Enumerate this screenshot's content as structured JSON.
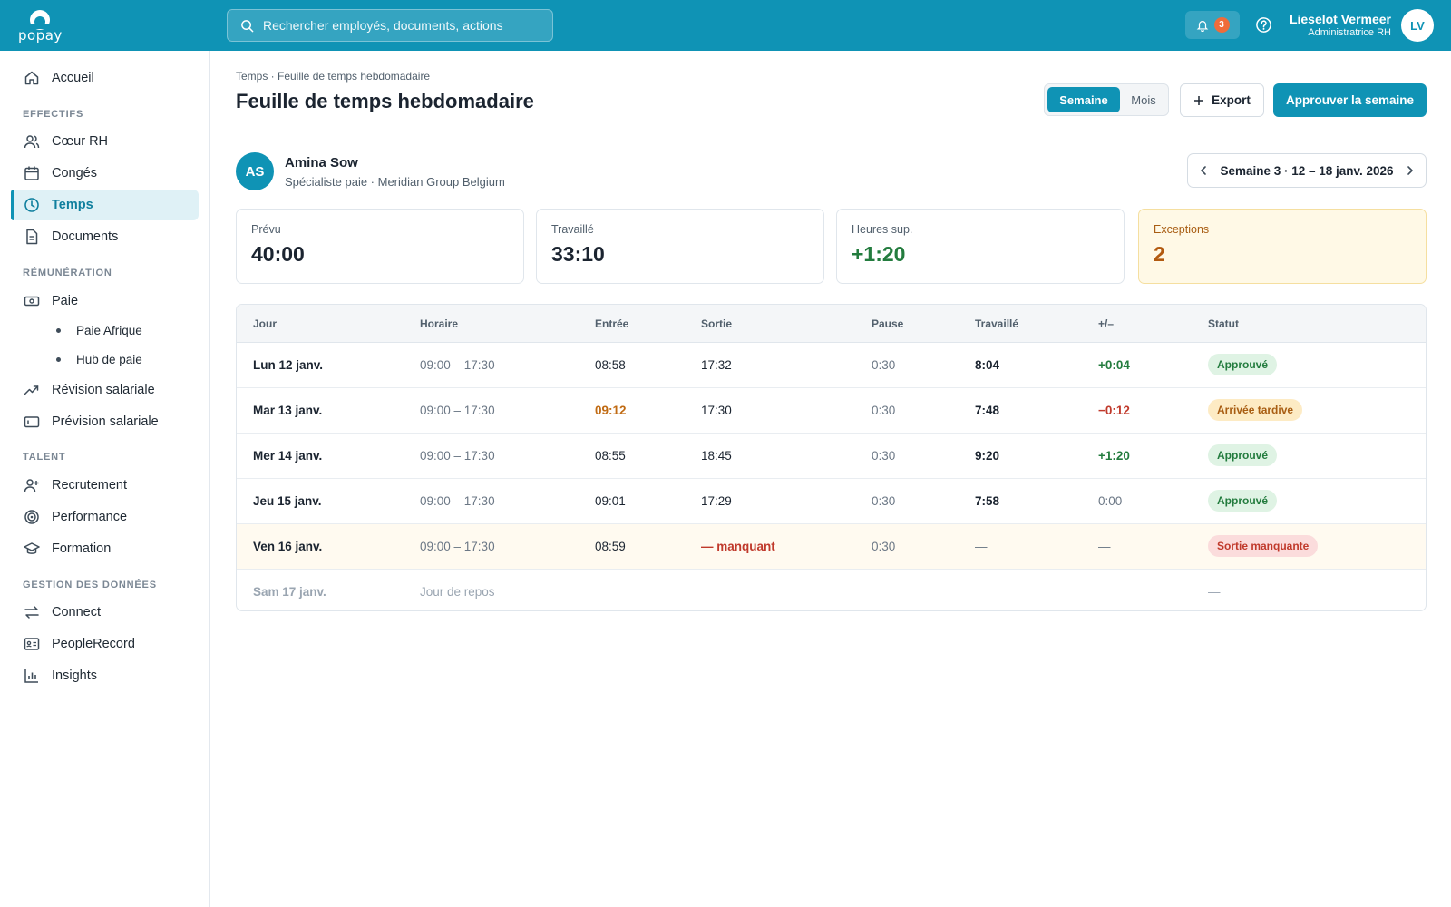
{
  "brand": {
    "name": "popay",
    "primary": "#0f93b5"
  },
  "search": {
    "placeholder": "Rechercher employés, documents, actions"
  },
  "notifications": {
    "count": "3"
  },
  "user": {
    "name": "Lieselot Vermeer",
    "role": "Administratrice RH",
    "initials": "LV"
  },
  "sidebar": {
    "home": "Accueil",
    "sections": {
      "effectifs": "EFFECTIFS",
      "remuneration": "RÉMUNÉRATION",
      "talent": "TALENT",
      "data": "GESTION DES DONNÉES"
    },
    "items": {
      "coeur_rh": "Cœur RH",
      "conges": "Congés",
      "temps": "Temps",
      "documents": "Documents",
      "paie": "Paie",
      "paie_afrique": "Paie Afrique",
      "hub_paie": "Hub de paie",
      "revision": "Révision salariale",
      "prevision": "Prévision salariale",
      "recrutement": "Recrutement",
      "performance": "Performance",
      "formation": "Formation",
      "connect": "Connect",
      "peoplerecord": "PeopleRecord",
      "insights": "Insights"
    }
  },
  "page": {
    "breadcrumb": "Temps · Feuille de temps hebdomadaire",
    "title": "Feuille de temps hebdomadaire",
    "view_toggle": {
      "week": "Semaine",
      "month": "Mois",
      "selected": "Semaine"
    },
    "export_label": "Export",
    "approve_label": "Approuver la semaine"
  },
  "employee": {
    "initials": "AS",
    "name": "Amina Sow",
    "meta": "Spécialiste paie · Meridian Group Belgium"
  },
  "week": {
    "label": "Semaine 3 · 12 – 18 janv. 2026"
  },
  "kpis": {
    "planned": {
      "label": "Prévu",
      "value": "40:00"
    },
    "worked": {
      "label": "Travaillé",
      "value": "33:10"
    },
    "overtime": {
      "label": "Heures sup.",
      "value": "+1:20"
    },
    "exceptions": {
      "label": "Exceptions",
      "value": "2"
    }
  },
  "table": {
    "headers": [
      "Jour",
      "Horaire",
      "Entrée",
      "Sortie",
      "Pause",
      "Travaillé",
      "+/–",
      "Statut"
    ],
    "rows": [
      {
        "day": "Lun 12 janv.",
        "schedule": "09:00 – 17:30",
        "in": "08:58",
        "out": "17:32",
        "pause": "0:30",
        "worked": "8:04",
        "diff": "+0:04",
        "status": "Approuvé"
      },
      {
        "day": "Mar 13 janv.",
        "schedule": "09:00 – 17:30",
        "in": "09:12",
        "out": "17:30",
        "pause": "0:30",
        "worked": "7:48",
        "diff": "−0:12",
        "status": "Arrivée tardive"
      },
      {
        "day": "Mer 14 janv.",
        "schedule": "09:00 – 17:30",
        "in": "08:55",
        "out": "18:45",
        "pause": "0:30",
        "worked": "9:20",
        "diff": "+1:20",
        "status": "Approuvé"
      },
      {
        "day": "Jeu 15 janv.",
        "schedule": "09:00 – 17:30",
        "in": "09:01",
        "out": "17:29",
        "pause": "0:30",
        "worked": "7:58",
        "diff": "0:00",
        "status": "Approuvé"
      },
      {
        "day": "Ven 16 janv.",
        "schedule": "09:00 – 17:30",
        "in": "08:59",
        "out": "— manquant",
        "pause": "0:30",
        "worked": "—",
        "diff": "—",
        "status": "Sortie manquante"
      },
      {
        "day": "Sam 17 janv.",
        "schedule": "Jour de repos",
        "status": "—"
      }
    ]
  }
}
